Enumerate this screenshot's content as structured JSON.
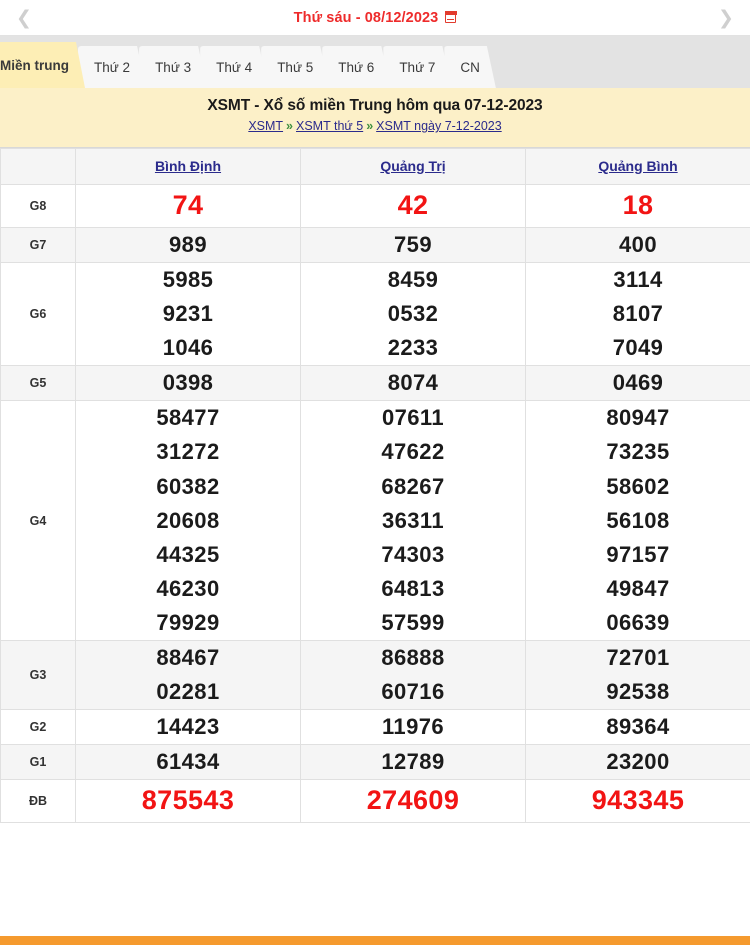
{
  "datebar": {
    "prev_icon": "chevron-left-icon",
    "next_icon": "chevron-right-icon",
    "date_text": "Thứ sáu - 08/12/2023",
    "calendar_icon": "calendar-icon",
    "date_color": "#ee2b2b"
  },
  "tabs": [
    {
      "label": "Miền trung",
      "active": true
    },
    {
      "label": "Thứ 2",
      "active": false
    },
    {
      "label": "Thứ 3",
      "active": false
    },
    {
      "label": "Thứ 4",
      "active": false
    },
    {
      "label": "Thứ 5",
      "active": false
    },
    {
      "label": "Thứ 6",
      "active": false
    },
    {
      "label": "Thứ 7",
      "active": false
    },
    {
      "label": "CN",
      "active": false
    }
  ],
  "header": {
    "title": "XSMT - Xổ số miền Trung hôm qua 07-12-2023",
    "breadcrumb": [
      "XSMT",
      "XSMT thứ 5",
      "XSMT ngày 7-12-2023"
    ],
    "breadcrumb_separator": "»",
    "background": "#fcf0c8"
  },
  "table": {
    "corner_label": "",
    "provinces": [
      "Bình Định",
      "Quảng Trị",
      "Quảng Bình"
    ],
    "rows": [
      {
        "label": "G8",
        "style": "red",
        "values": [
          [
            "74"
          ],
          [
            "42"
          ],
          [
            "18"
          ]
        ]
      },
      {
        "label": "G7",
        "style": "normal",
        "values": [
          [
            "989"
          ],
          [
            "759"
          ],
          [
            "400"
          ]
        ]
      },
      {
        "label": "G6",
        "style": "normal",
        "values": [
          [
            "5985",
            "9231",
            "1046"
          ],
          [
            "8459",
            "0532",
            "2233"
          ],
          [
            "3114",
            "8107",
            "7049"
          ]
        ]
      },
      {
        "label": "G5",
        "style": "normal",
        "values": [
          [
            "0398"
          ],
          [
            "8074"
          ],
          [
            "0469"
          ]
        ]
      },
      {
        "label": "G4",
        "style": "normal",
        "values": [
          [
            "58477",
            "31272",
            "60382",
            "20608",
            "44325",
            "46230",
            "79929"
          ],
          [
            "07611",
            "47622",
            "68267",
            "36311",
            "74303",
            "64813",
            "57599"
          ],
          [
            "80947",
            "73235",
            "58602",
            "56108",
            "97157",
            "49847",
            "06639"
          ]
        ]
      },
      {
        "label": "G3",
        "style": "normal",
        "values": [
          [
            "88467",
            "02281"
          ],
          [
            "86888",
            "60716"
          ],
          [
            "72701",
            "92538"
          ]
        ]
      },
      {
        "label": "G2",
        "style": "normal",
        "values": [
          [
            "14423"
          ],
          [
            "11976"
          ],
          [
            "89364"
          ]
        ]
      },
      {
        "label": "G1",
        "style": "normal",
        "values": [
          [
            "61434"
          ],
          [
            "12789"
          ],
          [
            "23200"
          ]
        ]
      },
      {
        "label": "ĐB",
        "style": "db",
        "values": [
          [
            "875543"
          ],
          [
            "274609"
          ],
          [
            "943345"
          ]
        ]
      }
    ]
  },
  "bottom_bar_color": "#f59a2e"
}
